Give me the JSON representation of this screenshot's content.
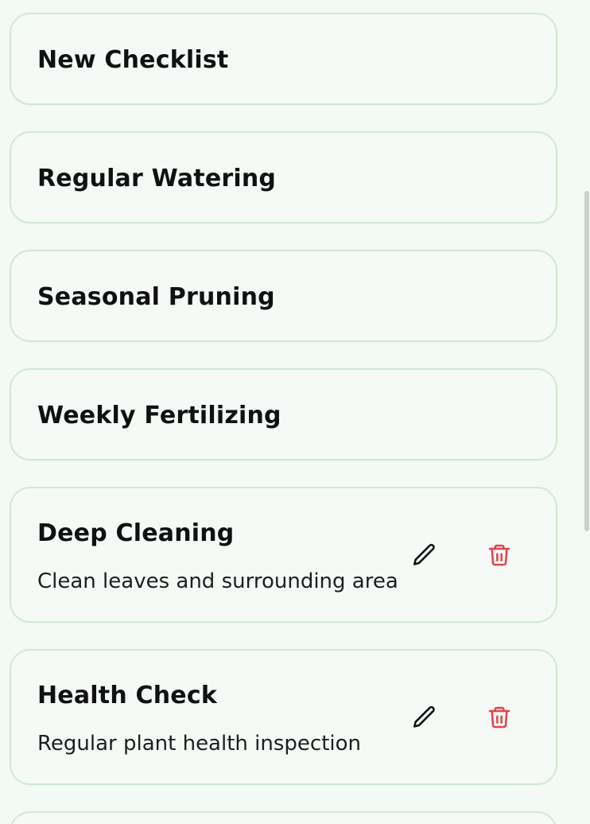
{
  "checklists": [
    {
      "title": "New Checklist"
    },
    {
      "title": "Regular Watering"
    },
    {
      "title": "Seasonal Pruning"
    },
    {
      "title": "Weekly Fertilizing"
    },
    {
      "title": "Deep Cleaning",
      "description": "Clean leaves and surrounding area",
      "edit_icon": "pencil-icon",
      "delete_icon": "trash-icon"
    },
    {
      "title": "Health Check",
      "description": "Regular plant health inspection",
      "edit_icon": "pencil-icon",
      "delete_icon": "trash-icon"
    }
  ],
  "colors": {
    "background": "#f3f9f4",
    "card_border": "#cfe9d3",
    "delete_red": "#e0454d",
    "text": "#111111"
  }
}
